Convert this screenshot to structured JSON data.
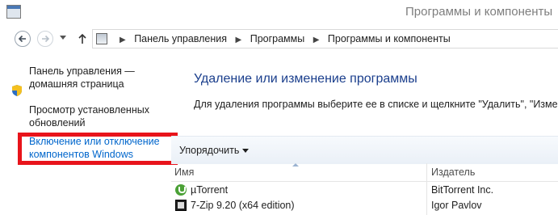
{
  "window": {
    "title": "Программы и компоненты"
  },
  "address_bar": {
    "crumbs": [
      "Панель управления",
      "Программы",
      "Программы и компоненты"
    ]
  },
  "sidebar": {
    "items": [
      {
        "label_line1": "Панель управления —",
        "label_line2": "домашняя страница"
      },
      {
        "label_line1": "Просмотр установленных",
        "label_line2": "обновлений"
      },
      {
        "label_line1": "Включение или отключение",
        "label_line2": "компонентов Windows"
      }
    ]
  },
  "main": {
    "title": "Удаление или изменение программы",
    "description": "Для удаления программы выберите ее в списке и щелкните \"Удалить\", \"Изменить\""
  },
  "toolbar": {
    "organize_label": "Упорядочить"
  },
  "table": {
    "columns": [
      "Имя",
      "Издатель"
    ],
    "rows": [
      {
        "name": "µTorrent",
        "publisher": "BitTorrent Inc.",
        "icon": "utorrent-icon"
      },
      {
        "name": "7-Zip 9.20 (x64 edition)",
        "publisher": "Igor Pavlov",
        "icon": "7zip-icon"
      }
    ]
  },
  "colors": {
    "link": "#0066cc",
    "heading": "#1a3e8c",
    "highlight": "#e8141b"
  }
}
